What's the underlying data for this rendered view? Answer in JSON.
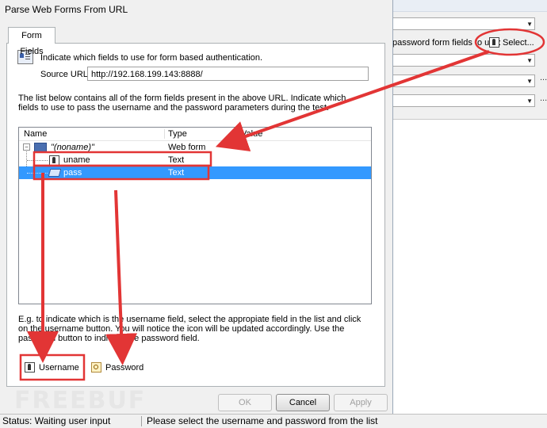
{
  "window": {
    "title": "Parse Web Forms From URL"
  },
  "tabs": [
    {
      "label": "Form Fields"
    }
  ],
  "intro": {
    "text": "Indicate which fields to use for form based authentication."
  },
  "source_url": {
    "label": "Source URL:",
    "value": "http://192.168.199.143:8888/"
  },
  "description": "The list below contains all of the form fields present in the above URL. Indicate which fields to use to pass the username and the password parameters during the test.",
  "listview": {
    "columns": [
      "Name",
      "Type",
      "Value"
    ],
    "rows": [
      {
        "name": "\"(noname)\"",
        "type": "Web form"
      },
      {
        "name": "uname",
        "type": "Text"
      },
      {
        "name": "pass",
        "type": "Text"
      }
    ]
  },
  "hint": "E.g. to indicate which is the username field, select the appropiate field in the list and click on the username button. You will notice the icon will be updated accordingly. Use the password button to indicate the password field.",
  "buttons": {
    "username": "Username",
    "password": "Password",
    "ok": "OK",
    "cancel": "Cancel",
    "apply": "Apply"
  },
  "background": {
    "label": "password form fields to use:",
    "select": "Select...",
    "ellipsis": "..."
  },
  "statusbar": {
    "left": "Status: Waiting user input",
    "right": "Please select the username and password from the list"
  },
  "watermark": "FREEBUF",
  "colors": {
    "selection": "#3399ff",
    "annotation": "#e23535"
  }
}
